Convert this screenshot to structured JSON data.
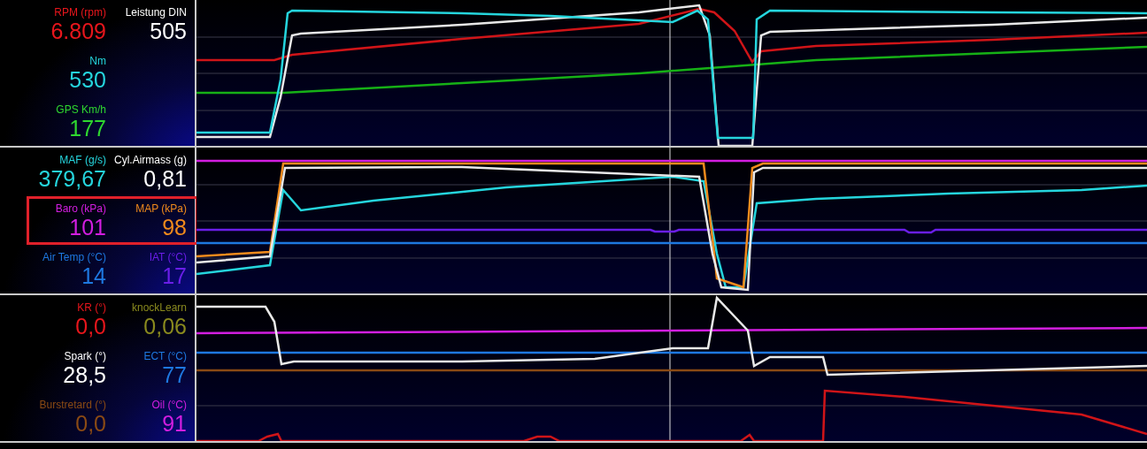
{
  "panels": [
    {
      "rows": [
        {
          "highlighted": false,
          "cells": [
            {
              "label": "RPM (rpm)",
              "value": "6.809",
              "color": "#e8161c"
            },
            {
              "label": "Leistung DIN",
              "value": "505",
              "color": "#ffffff"
            }
          ]
        },
        {
          "highlighted": false,
          "cells": [
            {
              "label": "Nm",
              "value": "530",
              "color": "#25d5dd"
            }
          ]
        },
        {
          "highlighted": false,
          "cells": [
            {
              "label": "GPS Km/h",
              "value": "177",
              "color": "#2fd82f"
            }
          ]
        }
      ]
    },
    {
      "rows": [
        {
          "highlighted": false,
          "cells": [
            {
              "label": "MAF (g/s)",
              "value": "379,67",
              "color": "#25d5dd"
            },
            {
              "label": "Cyl.Airmass (g)",
              "value": "0,81",
              "color": "#ffffff"
            }
          ]
        },
        {
          "highlighted": true,
          "cells": [
            {
              "label": "Baro (kPa)",
              "value": "101",
              "color": "#d21ee0"
            },
            {
              "label": "MAP (kPa)",
              "value": "98",
              "color": "#f08a1c"
            }
          ]
        },
        {
          "highlighted": false,
          "cells": [
            {
              "label": "Air Temp (°C)",
              "value": "14",
              "color": "#1e78e0"
            },
            {
              "label": "IAT (°C)",
              "value": "17",
              "color": "#6a1ee8"
            }
          ]
        }
      ]
    },
    {
      "rows": [
        {
          "highlighted": false,
          "cells": [
            {
              "label": "KR (°)",
              "value": "0,0",
              "color": "#e8161c"
            },
            {
              "label": "knockLearn",
              "value": "0,06",
              "color": "#8a8a1e"
            }
          ]
        },
        {
          "highlighted": false,
          "cells": [
            {
              "label": "Spark (°)",
              "value": "28,5",
              "color": "#ffffff"
            },
            {
              "label": "ECT (°C)",
              "value": "77",
              "color": "#1e78e0"
            }
          ]
        },
        {
          "highlighted": false,
          "cells": [
            {
              "label": "Burstretard (°)",
              "value": "0,0",
              "color": "#8a4a14"
            },
            {
              "label": "Oil (°C)",
              "value": "91",
              "color": "#d21ee0"
            }
          ]
        }
      ]
    }
  ]
}
